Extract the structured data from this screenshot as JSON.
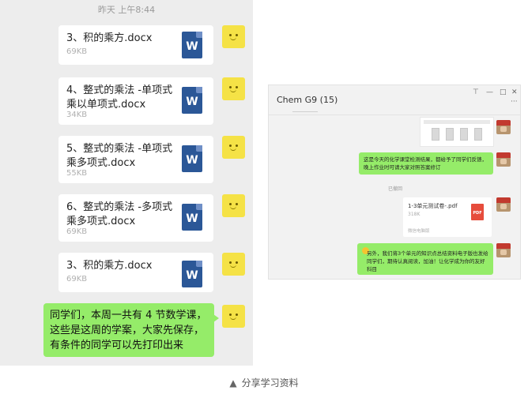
{
  "left_chat": {
    "timestamp": "昨天 上午8:44",
    "files": [
      {
        "name": "3、积的乘方.docx",
        "size": "69KB",
        "icon": "W"
      },
      {
        "name": "4、整式的乘法 -单项式乘以单项式.docx",
        "size": "34KB",
        "icon": "W"
      },
      {
        "name": "5、整式的乘法 -单项式乘多项式.docx",
        "size": "55KB",
        "icon": "W"
      },
      {
        "name": "6、整式的乘法 -多项式乘多项式.docx",
        "size": "69KB",
        "icon": "W"
      },
      {
        "name": "3、积的乘方.docx",
        "size": "69KB",
        "icon": "W"
      }
    ],
    "text_message": "同学们，本周一共有 4 节数学课，这些是这周的学案，大家先保存，有条件的同学可以先打印出来"
  },
  "right_window": {
    "title": "Chem G9 (15)",
    "controls": {
      "pin": "⊤",
      "minimize": "—",
      "maximize": "□",
      "close": "✕",
      "more": "···"
    },
    "message1": "这是今天的化学课堂检测结果，都给予了同学们反馈，晚上作业时可请大家对照答案修订",
    "system_note": "已撤回",
    "file": {
      "name": "1-3单元测试卷-.pdf",
      "size": "318K",
      "source": "微信电脑版",
      "icon": "PDF"
    },
    "message2": "另外，我们将3个单元的知识点总结资料电子版也发给同学们，期待认真阅读，加油！让化学成为你的友好科目"
  },
  "caption": {
    "marker": "▲",
    "text": "分享学习资料"
  },
  "colors": {
    "bubble_green": "#95ec69",
    "chat_bg": "#ededed",
    "word_blue": "#2b5797",
    "pdf_red": "#e64c3c",
    "avatar_yellow": "#f5e246"
  }
}
